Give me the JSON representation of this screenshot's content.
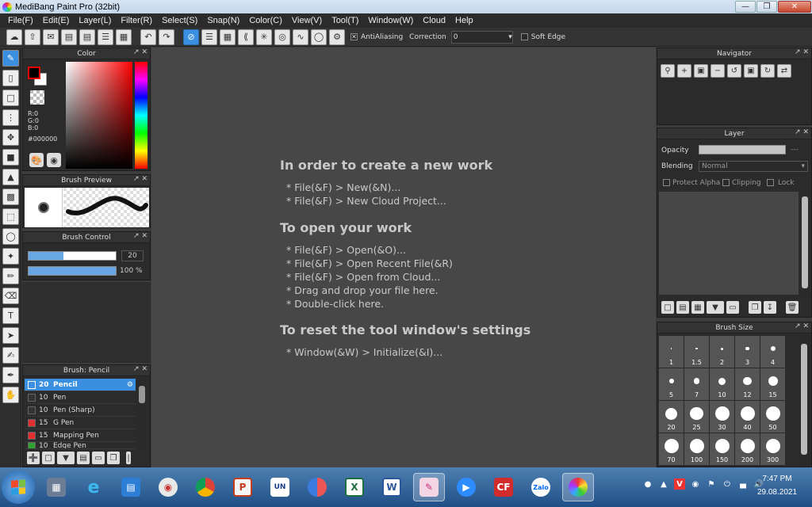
{
  "window": {
    "title": "MediBang Paint Pro (32bit)"
  },
  "menu": [
    "File(F)",
    "Edit(E)",
    "Layer(L)",
    "Filter(R)",
    "Select(S)",
    "Snap(N)",
    "Color(C)",
    "View(V)",
    "Tool(T)",
    "Window(W)",
    "Cloud",
    "Help"
  ],
  "toolbar": {
    "antialiasing_label": "AntiAliasing",
    "antialiasing_checked": "✕",
    "correction_label": "Correction",
    "correction_value": "0",
    "soft_edge_label": "Soft Edge"
  },
  "color_panel": {
    "title": "Color",
    "r": "R:0",
    "g": "G:0",
    "b": "B:0",
    "hex": "#000000",
    "fg_color": "#000000",
    "bg_color": "#ffffff"
  },
  "brush_preview": {
    "title": "Brush Preview"
  },
  "brush_control": {
    "title": "Brush Control",
    "size_value": "20",
    "size_fraction": 0.4,
    "opacity_value": "100 %",
    "opacity_fraction": 1.0
  },
  "brush_list": {
    "title": "Brush: Pencil",
    "items": [
      {
        "size": "20",
        "name": "Pencil",
        "color": "#3b8fe0"
      },
      {
        "size": "10",
        "name": "Pen",
        "color": "#333333"
      },
      {
        "size": "10",
        "name": "Pen (Sharp)",
        "color": "#333333"
      },
      {
        "size": "15",
        "name": "G Pen",
        "color": "#e03030"
      },
      {
        "size": "15",
        "name": "Mapping Pen",
        "color": "#e03030"
      },
      {
        "size": "10",
        "name": "Edge Pen",
        "color": "#30a030"
      }
    ]
  },
  "canvas": {
    "new_work_heading": "In order to create a new work",
    "new_work_1": "* File(&F) > New(&N)...",
    "new_work_2": "* File(&F) > New Cloud Project...",
    "open_heading": "To open your work",
    "open_1": "* File(&F) > Open(&O)...",
    "open_2": "* File(&F) > Open Recent File(&R)",
    "open_3": "* File(&F) > Open from Cloud...",
    "open_4": "* Drag and drop your file here.",
    "open_5": "* Double-click here.",
    "reset_heading": "To reset the tool window's settings",
    "reset_1": "* Window(&W) > Initialize(&I)..."
  },
  "navigator": {
    "title": "Navigator"
  },
  "layer": {
    "title": "Layer",
    "opacity_label": "Opacity",
    "opacity_value": "---",
    "blending_label": "Blending",
    "blending_value": "Normal",
    "protect_alpha": "Protect Alpha",
    "clipping": "Clipping",
    "lock": "Lock"
  },
  "brush_size": {
    "title": "Brush Size",
    "sizes": [
      "1",
      "1.5",
      "2",
      "3",
      "4",
      "5",
      "7",
      "10",
      "12",
      "15",
      "20",
      "25",
      "30",
      "40",
      "50",
      "70",
      "100",
      "150",
      "200",
      "300"
    ]
  },
  "taskbar": {
    "time": "7:47 PM",
    "date": "29.08.2021"
  },
  "colors": {
    "accent": "#3b8fe0",
    "canvas": "#474747",
    "panel": "#2b2b2b"
  }
}
